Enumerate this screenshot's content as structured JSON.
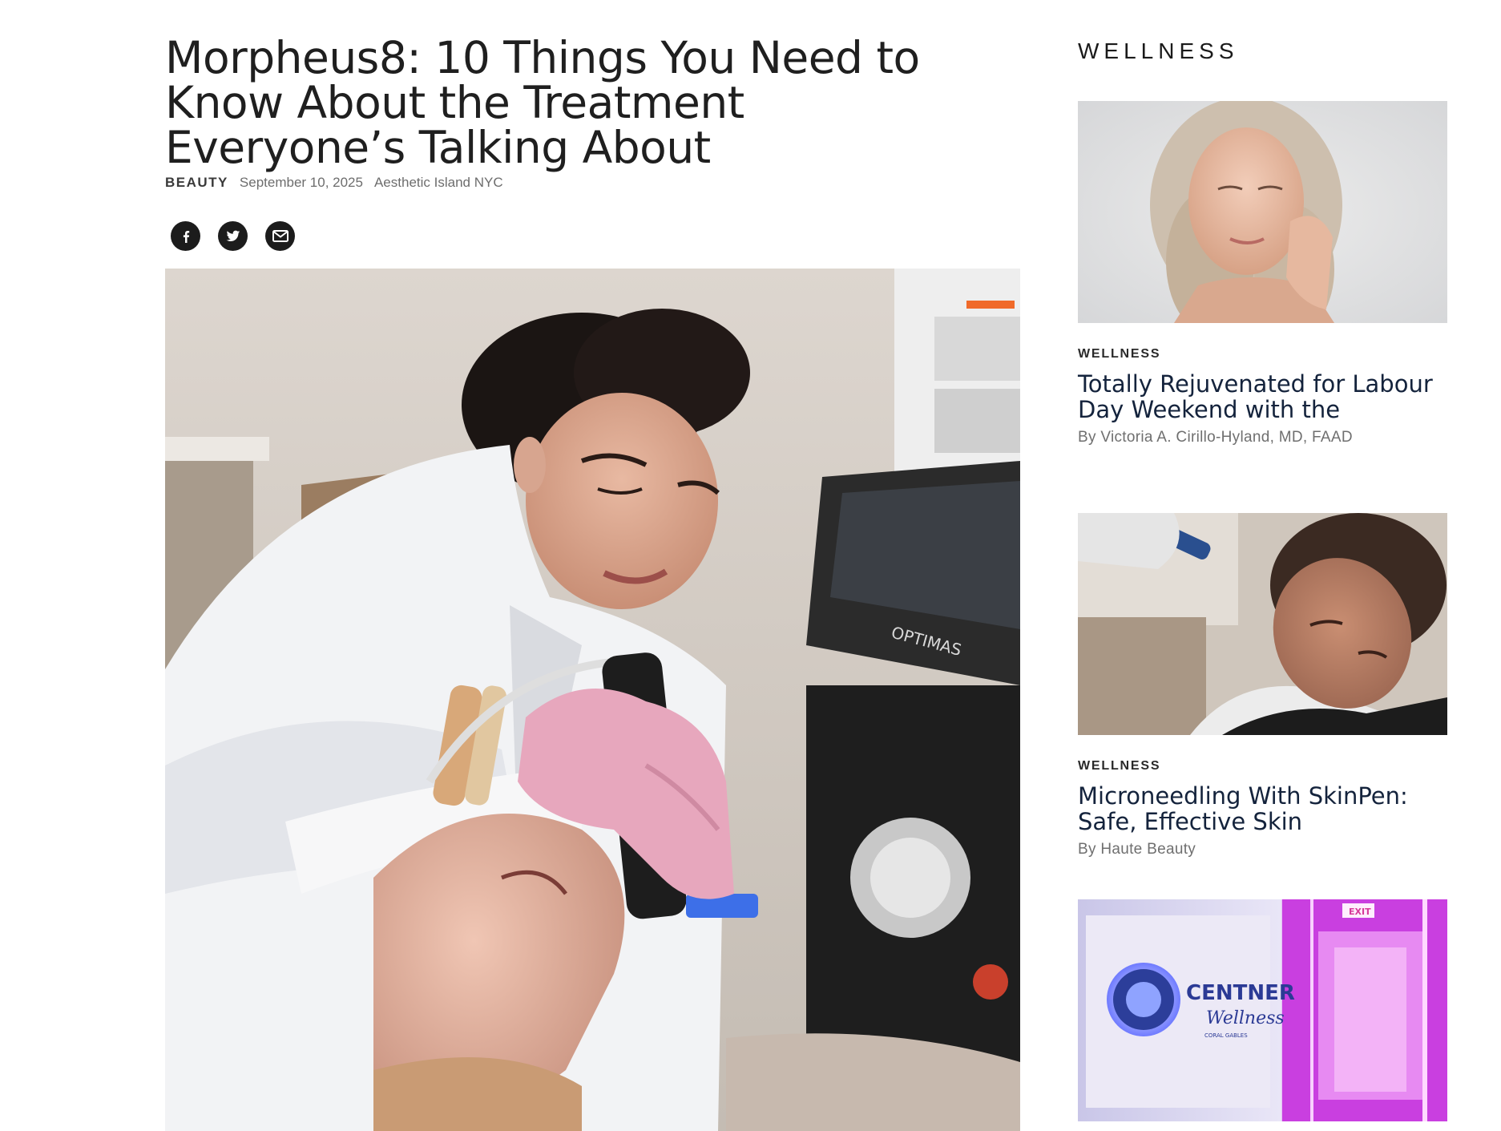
{
  "article": {
    "title": "Morpheus8: 10 Things You Need to Know About the Treatment Everyone’s Talking About",
    "category": "BEAUTY",
    "date": "September 10, 2025",
    "author": "Aesthetic Island NYC",
    "share": [
      "facebook-icon",
      "twitter-icon",
      "email-icon"
    ],
    "hero_image_text": "OPTIMAS"
  },
  "sidebar": {
    "heading": "WELLNESS",
    "cards": [
      {
        "category": "WELLNESS",
        "title": "Totally Rejuvenated for Labour Day Weekend with the",
        "byline": "By Victoria A. Cirillo-Hyland, MD, FAAD"
      },
      {
        "category": "WELLNESS",
        "title": "Microneedling With SkinPen: Safe, Effective Skin",
        "byline": "By Haute Beauty"
      },
      {
        "logo_text_1": "CENTNER",
        "logo_text_2": "Wellness",
        "logo_text_3": "CORAL GABLES",
        "exit_sign": "EXIT"
      }
    ]
  },
  "colors": {
    "title_text": "#1f1f1f",
    "sidebar_title": "#14233c",
    "share_button": "#1c1c1c"
  }
}
